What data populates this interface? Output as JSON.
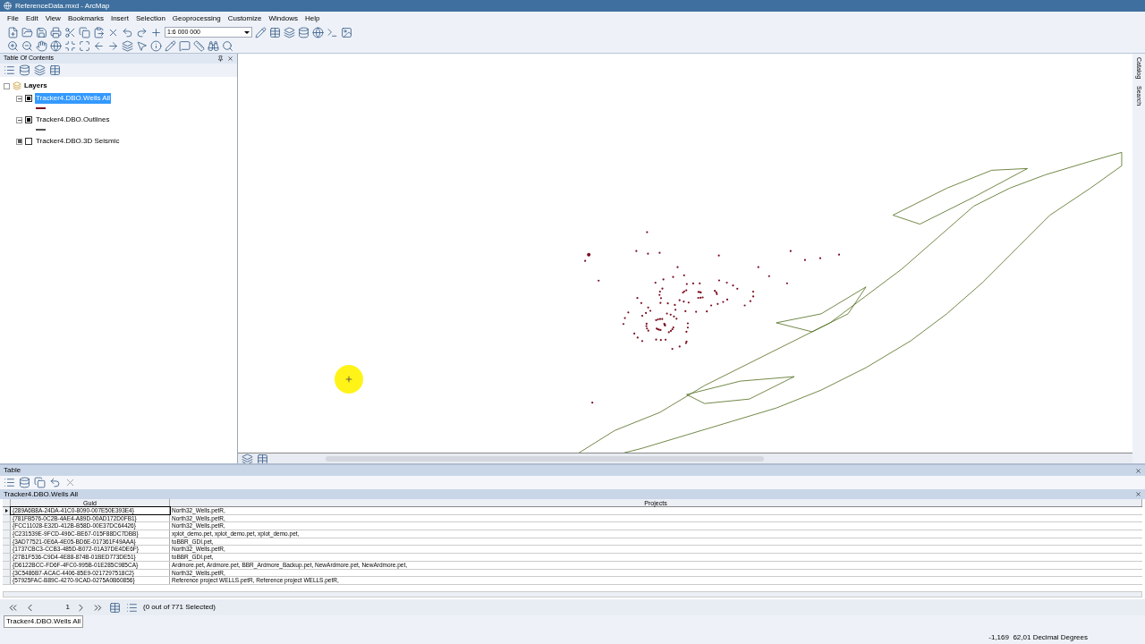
{
  "window": {
    "title": "ReferenceData.mxd - ArcMap"
  },
  "menu": [
    "File",
    "Edit",
    "View",
    "Bookmarks",
    "Insert",
    "Selection",
    "Geoprocessing",
    "Customize",
    "Windows",
    "Help"
  ],
  "scale": {
    "value": "1:6 000 000"
  },
  "toc": {
    "title": "Table Of Contents",
    "root": "Layers",
    "layers": [
      {
        "name": "Tracker4.DBO.Wells All",
        "checked": true,
        "selected": true,
        "expanded": true,
        "color": "#7a1020"
      },
      {
        "name": "Tracker4.DBO.Outlines",
        "checked": true,
        "selected": false,
        "expanded": true,
        "color": "#555555"
      },
      {
        "name": "Tracker4.DBO.3D Seismic",
        "checked": false,
        "selected": false,
        "expanded": false
      }
    ]
  },
  "side_tabs": [
    "Catalog",
    "Search"
  ],
  "table": {
    "title": "Table",
    "tab": "Tracker4.DBO.Wells All",
    "columns": [
      "Guid",
      "Projects"
    ],
    "rows": [
      {
        "guid": "{289A6B8A-24DA-41C0-8090-007E50E393E4}",
        "projects": "North32_Wells.petR,",
        "current": true
      },
      {
        "guid": "{781FB576-0C2B-4AE4-A89D-00AD172D0FB1}",
        "projects": "North32_Wells.petR,",
        "current": false
      },
      {
        "guid": "{FCC11028-E32D-412B-B58D-00E37DC64426}",
        "projects": "North32_Wells.petR,",
        "current": false
      },
      {
        "guid": "{C231539E-9FCD-496C-BE67-015F88DC7DBB}",
        "projects": "xplot_demo.pet, xplot_demo.pet, xplot_demo.pet,",
        "current": false
      },
      {
        "guid": "{3AD77521-0E6A-4E05-BD6E-017361F49AAA}",
        "projects": "toBBR_GDI.pet,",
        "current": false
      },
      {
        "guid": "{1737CBC3-CCB3-485D-B072-01A37DE4DE6F}",
        "projects": "North32_Wells.petR,",
        "current": false
      },
      {
        "guid": "{27B1F536-C9D4-4E88-874B-01BED773DE51}",
        "projects": "toBBR_GDI.pet,",
        "current": false
      },
      {
        "guid": "{D6122BCC-FD6F-4FC0-995B-01E285C985CA}",
        "projects": "Ardmore.pet, Ardmore.pet, BBR_Ardmore_Backup.pet, NewArdmore.pet, NewArdmore.pet,",
        "current": false
      },
      {
        "guid": "{3C5486B7-ACAC-4406-85E9-0217297518C2}",
        "projects": "North32_Wells.petR,",
        "current": false
      },
      {
        "guid": "{57925FAC-B89C-4270-9CAD-0275A0B60856}",
        "projects": "Reference project WELLS.petR, Reference project WELLS.petR,",
        "current": false
      }
    ],
    "page": "1",
    "selection": "(0 out of 771 Selected)"
  },
  "status_bar": {
    "tab": "Tracker4.DBO.Wells All",
    "coordinates": "-1,169  62,01 Decimal Degrees"
  }
}
